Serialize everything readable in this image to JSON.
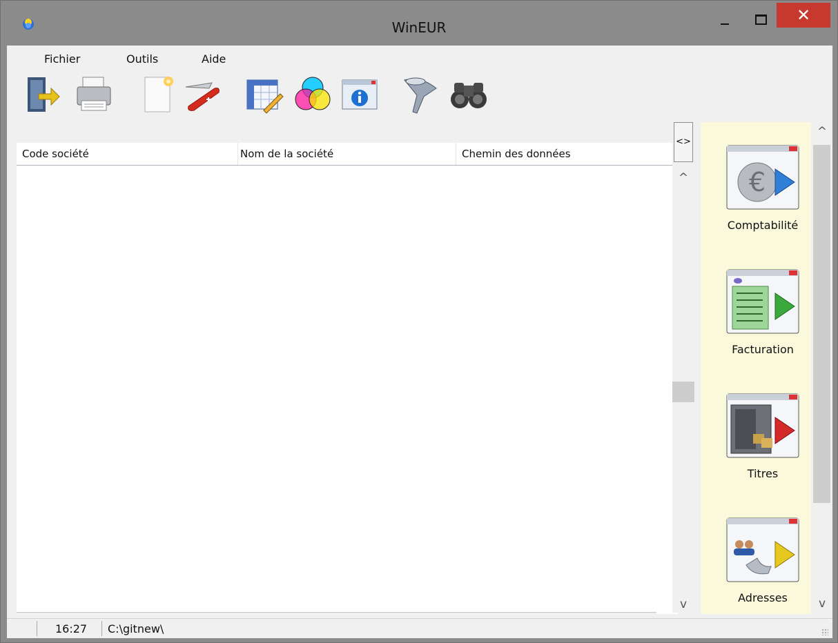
{
  "window": {
    "title": "WinEUR",
    "close_glyph": "✕"
  },
  "menu": {
    "items": [
      "Fichier",
      "Outils",
      "Aide"
    ]
  },
  "toolbar": {
    "tools": [
      "exit-door-icon",
      "printer-icon",
      "new-document-icon",
      "swiss-knife-icon",
      "table-edit-icon",
      "color-wheel-icon",
      "info-window-icon",
      "filter-funnel-icon",
      "binoculars-icon"
    ]
  },
  "table": {
    "columns": [
      "Code société",
      "Nom de la société",
      "Chemin des données"
    ],
    "rows": []
  },
  "collapse_button": "<>",
  "modules": [
    {
      "label": "Comptabilité",
      "icon": "euro-play-icon",
      "accent": "#2f7fd6"
    },
    {
      "label": "Facturation",
      "icon": "invoice-play-icon",
      "accent": "#3aa83a"
    },
    {
      "label": "Titres",
      "icon": "safe-play-icon",
      "accent": "#d42a2a"
    },
    {
      "label": "Adresses",
      "icon": "contacts-phone-play-icon",
      "accent": "#e6c81e"
    }
  ],
  "scroll": {
    "up_glyph": "^",
    "down_glyph": "v"
  },
  "status": {
    "time": "16:27",
    "path": "C:\\gitnew\\"
  },
  "colors": {
    "titlebar": "#8b8b8b",
    "close_button": "#c7392e",
    "side_panel": "#fbf9dc"
  }
}
